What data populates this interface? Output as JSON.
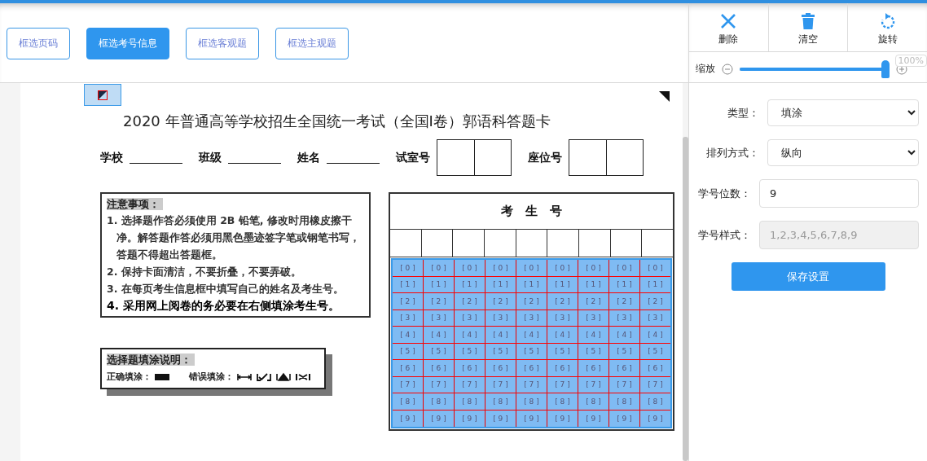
{
  "toolbar": {
    "buttons": [
      {
        "label": "框选页码",
        "selected": false
      },
      {
        "label": "框选考号信息",
        "selected": true
      },
      {
        "label": "框选客观题",
        "selected": false
      },
      {
        "label": "框选主观题",
        "selected": false
      }
    ]
  },
  "tools": [
    {
      "kind": "delete",
      "label": "删除"
    },
    {
      "kind": "clear",
      "label": "清空"
    },
    {
      "kind": "rotate",
      "label": "旋转"
    }
  ],
  "zoom": {
    "label": "缩放",
    "level": 1,
    "reading": "100%"
  },
  "sheet": {
    "title": "2020 年普通高等学校招生全国统一考试（全国I卷）郭语科答题卡",
    "info_fields": [
      {
        "label": "学校",
        "kind": "line"
      },
      {
        "label": "班级",
        "kind": "line"
      },
      {
        "label": "姓名",
        "kind": "line"
      },
      {
        "label": "试室号",
        "kind": "boxes"
      },
      {
        "label": "座位号",
        "kind": "boxes"
      }
    ],
    "notice": {
      "heading": "注意事项：",
      "items": [
        {
          "text": "1. 选择题作答必须使用 2B 铅笔, 修改时用橡皮擦干净。解答题作答必须用黑色墨迹签字笔或钢笔书写，答题不得超出答题框。",
          "bold": false
        },
        {
          "text": "2. 保持卡面清洁，不要折叠，不要弄破。",
          "bold": false
        },
        {
          "text": "3. 在每页考生信息框中填写自己的姓名及考生号。",
          "bold": false
        },
        {
          "text": "4. 采用网上阅卷的务必要在右侧填涂考生号。",
          "bold": true
        }
      ]
    },
    "fill_guide": {
      "heading": "选择题填涂说明：",
      "correct_label": "正确填涂：",
      "wrong_label": "错误填涂："
    },
    "exam_number": {
      "heading": "考　生　号",
      "rows": [
        [
          "[ 0 ]",
          "[ 0 ]",
          "[ 0 ]",
          "[ 0 ]",
          "[ 0 ]",
          "[ 0 ]",
          "[ 0 ]",
          "[ 0 ]",
          "[ 0 ]"
        ],
        [
          "[ 1 ]",
          "[ 1 ]",
          "[ 1 ]",
          "[ 1 ]",
          "[ 1 ]",
          "[ 1 ]",
          "[ 1 ]",
          "[ 1 ]",
          "[ 1 ]"
        ],
        [
          "[ 2 ]",
          "[ 2 ]",
          "[ 2 ]",
          "[ 2 ]",
          "[ 2 ]",
          "[ 2 ]",
          "[ 2 ]",
          "[ 2 ]",
          "[ 2 ]"
        ],
        [
          "[ 3 ]",
          "[ 3 ]",
          "[ 3 ]",
          "[ 3 ]",
          "[ 3 ]",
          "[ 3 ]",
          "[ 3 ]",
          "[ 3 ]",
          "[ 3 ]"
        ],
        [
          "[ 4 ]",
          "[ 4 ]",
          "[ 4 ]",
          "[ 4 ]",
          "[ 4 ]",
          "[ 4 ]",
          "[ 4 ]",
          "[ 4 ]",
          "[ 4 ]"
        ],
        [
          "[ 5 ]",
          "[ 5 ]",
          "[ 5 ]",
          "[ 5 ]",
          "[ 5 ]",
          "[ 5 ]",
          "[ 5 ]",
          "[ 5 ]",
          "[ 5 ]"
        ],
        [
          "[ 6 ]",
          "[ 6 ]",
          "[ 6 ]",
          "[ 6 ]",
          "[ 6 ]",
          "[ 6 ]",
          "[ 6 ]",
          "[ 6 ]",
          "[ 6 ]"
        ],
        [
          "[ 7 ]",
          "[ 7 ]",
          "[ 7 ]",
          "[ 7 ]",
          "[ 7 ]",
          "[ 7 ]",
          "[ 7 ]",
          "[ 7 ]",
          "[ 7 ]"
        ],
        [
          "[ 8 ]",
          "[ 8 ]",
          "[ 8 ]",
          "[ 8 ]",
          "[ 8 ]",
          "[ 8 ]",
          "[ 8 ]",
          "[ 8 ]",
          "[ 8 ]"
        ],
        [
          "[ 9 ]",
          "[ 9 ]",
          "[ 9 ]",
          "[ 9 ]",
          "[ 9 ]",
          "[ 9 ]",
          "[ 9 ]",
          "[ 9 ]",
          "[ 9 ]"
        ]
      ]
    }
  },
  "settings": {
    "fields": [
      {
        "label": "类型：",
        "kind": "select",
        "value": "填涂"
      },
      {
        "label": "排列方式：",
        "kind": "select",
        "value": "纵向"
      },
      {
        "label": "学号位数：",
        "kind": "input",
        "value": "9"
      },
      {
        "label": "学号样式：",
        "kind": "input",
        "value": "1,2,3,4,5,6,7,8,9",
        "disabled": true
      }
    ],
    "save_button": "保存设置"
  }
}
